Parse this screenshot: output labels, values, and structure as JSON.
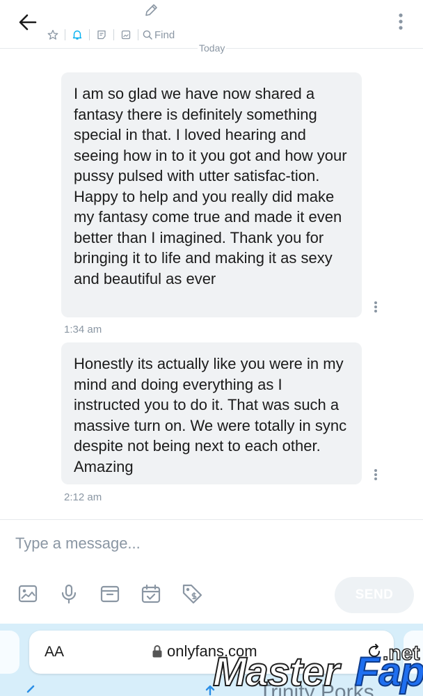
{
  "header": {
    "find_label": "Find",
    "icons": [
      "back-arrow-icon",
      "pencil-icon",
      "star-icon",
      "bell-icon",
      "note-icon",
      "image-icon",
      "search-icon",
      "more-vertical-icon"
    ],
    "accent_color": "#00aff0"
  },
  "divider": {
    "date_label": "Today"
  },
  "messages": [
    {
      "text": "I am so glad we have now shared a fantasy there is definitely something special in that. I loved hearing and seeing how in to it you got and how your pussy pulsed with utter satisfac-tion. Happy to help and you really did make my fantasy come true and made it even better than I imagined. Thank you for bringing it to life and making it as sexy and beautiful as ever",
      "time": "1:34 am"
    },
    {
      "text": "Honestly its actually like you were in my mind and doing everything as I instructed you to do it. That was such a massive turn on. We were totally in sync despite not being next to each other. Amazing",
      "time": "2:12 am"
    }
  ],
  "composer": {
    "placeholder": "Type a message...",
    "send_label": "SEND",
    "actions": [
      "image-icon",
      "microphone-icon",
      "vault-icon",
      "calendar-icon",
      "price-tag-icon"
    ]
  },
  "browser": {
    "aa_label": "AA",
    "url": "onlyfans.com",
    "next_tab_title": "Trinity Porks"
  },
  "watermark": {
    "brand_master": "Master",
    "brand_fap": "Fap",
    "brand_tld": ".net"
  }
}
